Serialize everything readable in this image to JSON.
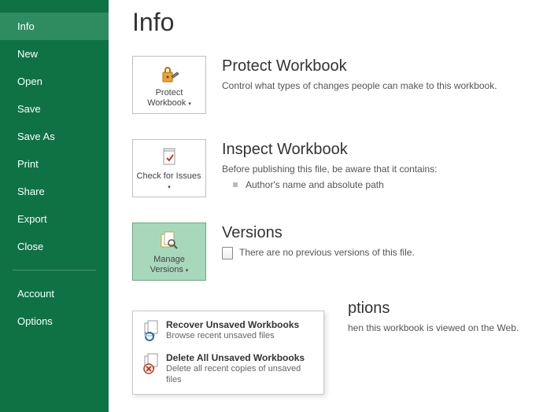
{
  "sidebar": {
    "items": [
      {
        "label": "Info",
        "active": true
      },
      {
        "label": "New"
      },
      {
        "label": "Open"
      },
      {
        "label": "Save"
      },
      {
        "label": "Save As"
      },
      {
        "label": "Print"
      },
      {
        "label": "Share"
      },
      {
        "label": "Export"
      },
      {
        "label": "Close"
      }
    ],
    "footer": [
      {
        "label": "Account"
      },
      {
        "label": "Options"
      }
    ]
  },
  "page_title": "Info",
  "sections": {
    "protect": {
      "tile_label": "Protect Workbook",
      "title": "Protect Workbook",
      "desc": "Control what types of changes people can make to this workbook."
    },
    "inspect": {
      "tile_label": "Check for Issues",
      "title": "Inspect Workbook",
      "desc": "Before publishing this file, be aware that it contains:",
      "bullet": "Author's name and absolute path"
    },
    "versions": {
      "tile_label": "Manage Versions",
      "title": "Versions",
      "desc": "There are no previous versions of this file."
    },
    "browser": {
      "title_fragment": "ptions",
      "desc_fragment": "hen this workbook is viewed on the Web."
    }
  },
  "popup": {
    "recover": {
      "title": "Recover Unsaved Workbooks",
      "sub": "Browse recent unsaved files"
    },
    "delete": {
      "title": "Delete All Unsaved Workbooks",
      "sub": "Delete all recent copies of unsaved files"
    }
  }
}
